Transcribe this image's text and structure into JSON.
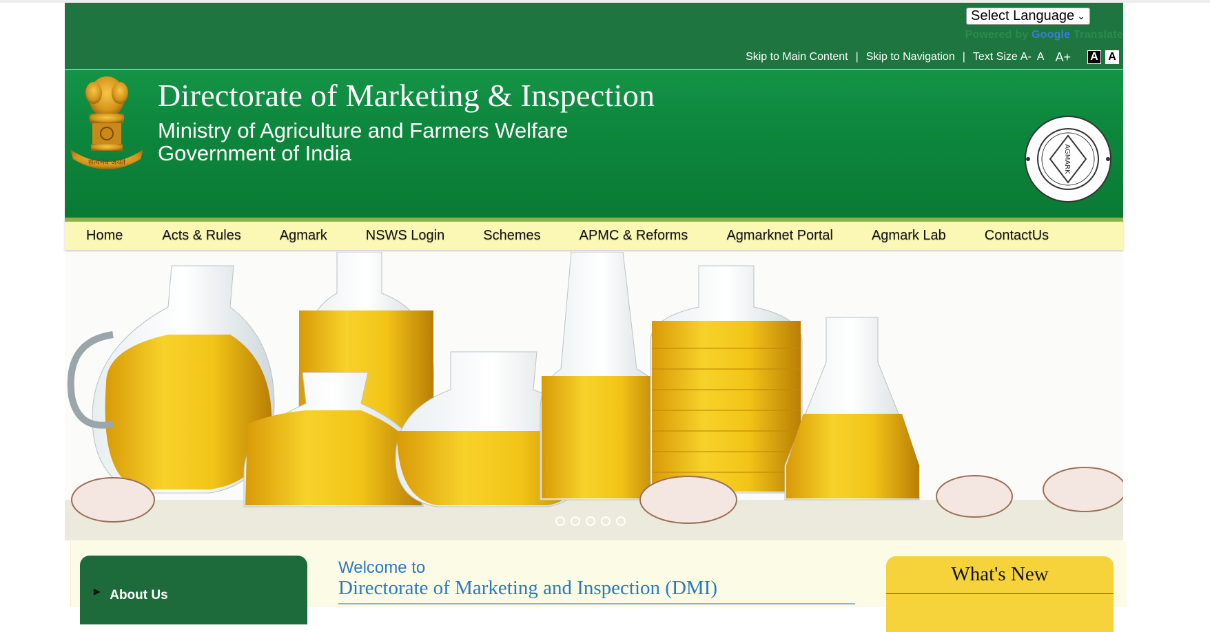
{
  "utility_bar": {
    "language_select": "Select Language",
    "powered_by": "Powered by",
    "google": "Google",
    "translate": "Translate",
    "skip_main": "Skip to Main Content",
    "skip_nav": "Skip to Navigation",
    "text_size_label": "Text Size",
    "size_small": "A-",
    "size_normal": "A",
    "size_large": "A+",
    "contrast_dark": "A",
    "contrast_light": "A"
  },
  "header": {
    "title": "Directorate of Marketing & Inspection",
    "ministry": "Ministry of Agriculture and Farmers Welfare",
    "government": "Government of India"
  },
  "nav": {
    "items": [
      "Home",
      "Acts & Rules",
      "Agmark",
      "NSWS Login",
      "Schemes",
      "APMC & Reforms",
      "Agmarknet Portal",
      "Agmark Lab",
      "ContactUs"
    ]
  },
  "slider": {
    "slide_count": 5
  },
  "sidebar": {
    "first_item": "About Us"
  },
  "welcome": {
    "line1": "Welcome to",
    "line2": "Directorate of Marketing and Inspection (DMI)"
  },
  "whats_new": {
    "heading": "What's New"
  },
  "colors": {
    "header_green": "#1e7540",
    "banner_green": "#0d873d",
    "nav_bg": "#fbf7b4",
    "accent_yellow": "#f6d33a",
    "link_blue": "#2a7ac0"
  }
}
